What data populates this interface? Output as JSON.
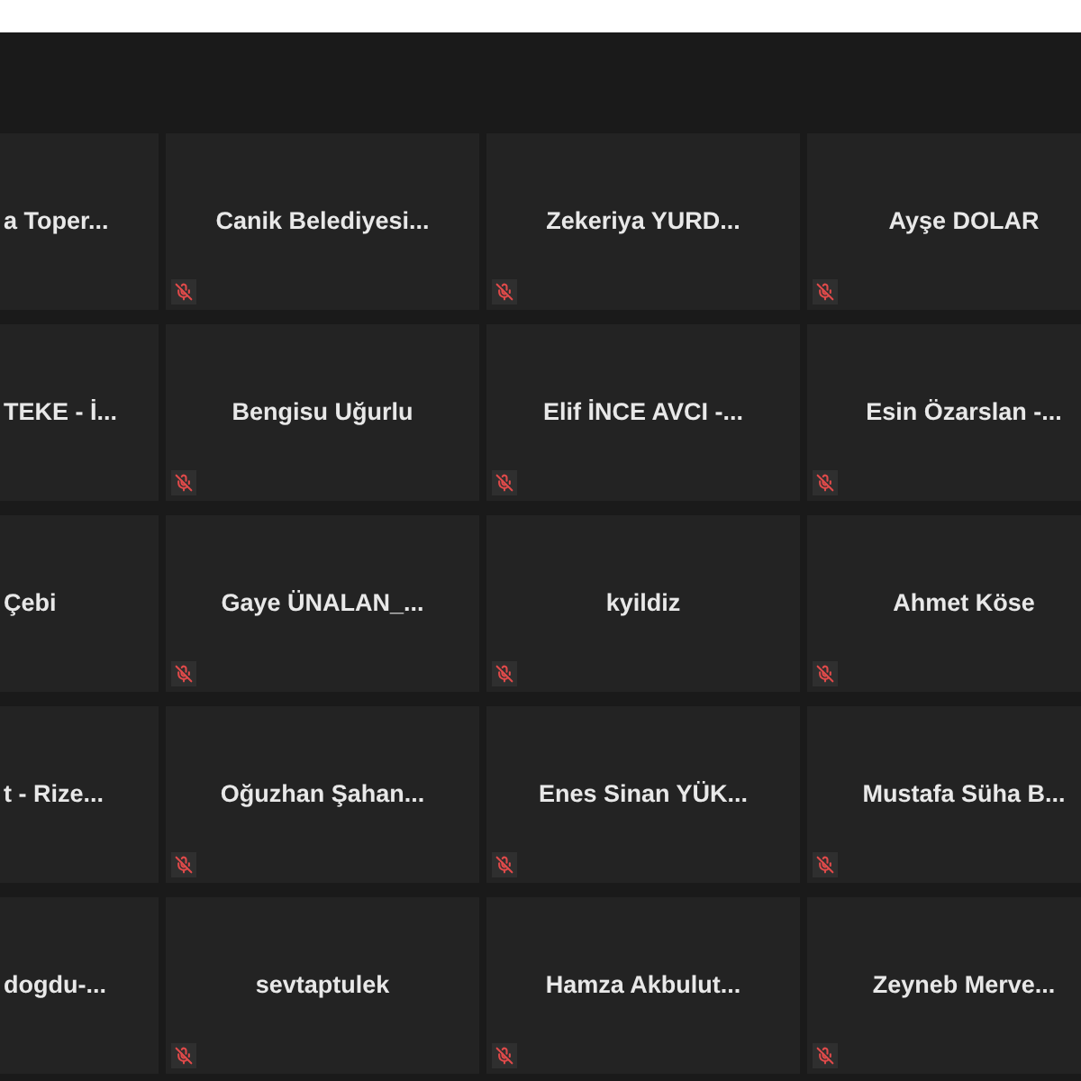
{
  "tiles": [
    {
      "name": "a Toper...",
      "kind": "clipped"
    },
    {
      "name": "Canik Belediyesi...",
      "kind": "full",
      "muted": true
    },
    {
      "name": "Zekeriya YURD...",
      "kind": "full",
      "muted": true
    },
    {
      "name": "Ayşe DOLAR",
      "kind": "full",
      "muted": true
    },
    {
      "name": "TEKE - İ...",
      "kind": "clipped"
    },
    {
      "name": "Bengisu Uğurlu",
      "kind": "full",
      "muted": true
    },
    {
      "name": "Elif İNCE AVCI -...",
      "kind": "full",
      "muted": true
    },
    {
      "name": "Esin Özarslan -...",
      "kind": "full",
      "muted": true
    },
    {
      "name": "Çebi",
      "kind": "clipped"
    },
    {
      "name": "Gaye ÜNALAN_...",
      "kind": "full",
      "muted": true
    },
    {
      "name": "kyildiz",
      "kind": "full",
      "muted": true
    },
    {
      "name": "Ahmet Köse",
      "kind": "full",
      "muted": true
    },
    {
      "name": "t - Rize...",
      "kind": "clipped"
    },
    {
      "name": "Oğuzhan Şahan...",
      "kind": "full",
      "muted": true
    },
    {
      "name": "Enes Sinan YÜK...",
      "kind": "full",
      "muted": true
    },
    {
      "name": "Mustafa Süha B...",
      "kind": "full",
      "muted": true
    },
    {
      "name": "dogdu-...",
      "kind": "clipped"
    },
    {
      "name": "sevtaptulek",
      "kind": "full",
      "muted": true
    },
    {
      "name": "Hamza Akbulut...",
      "kind": "full",
      "muted": true
    },
    {
      "name": "Zeyneb Merve...",
      "kind": "full",
      "muted": true
    }
  ]
}
